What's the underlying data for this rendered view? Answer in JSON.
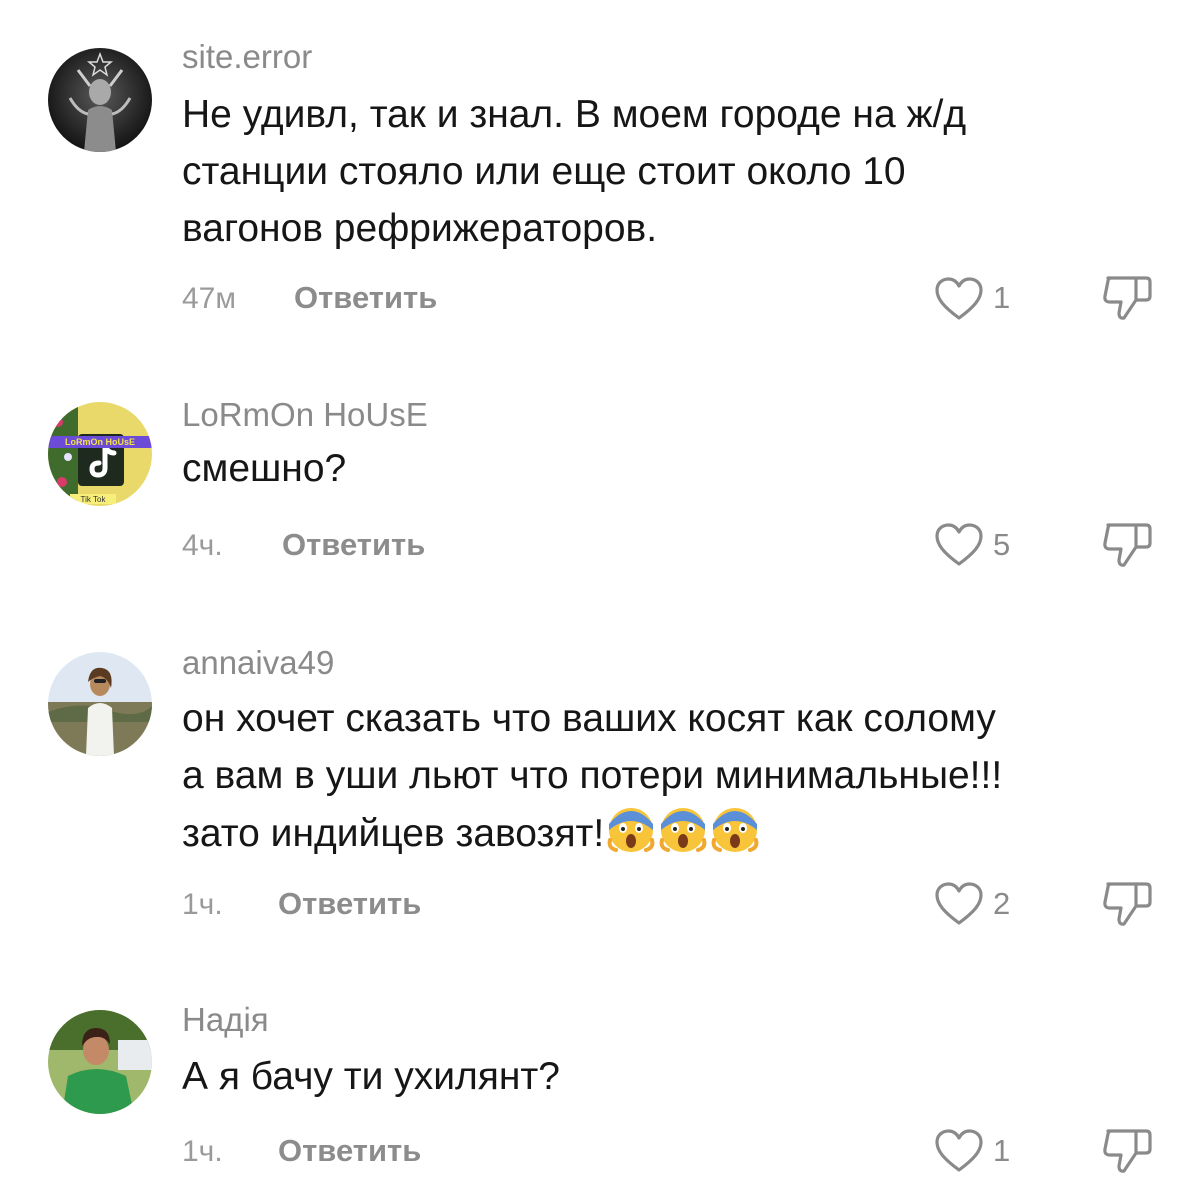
{
  "colors": {
    "username": "#8a8a8a",
    "text": "#161616",
    "meta": "#9a9a9a",
    "reply": "#8c8c8c",
    "icon": "#8a8a8a"
  },
  "comments": [
    {
      "username": "site.error",
      "text": "Не удивл, так и знал. В моем городе на ж/д\nстанции стояло или еще стоит около 10\nвагонов рефрижераторов.",
      "time": "47м",
      "reply_label": "Ответить",
      "likes": "1",
      "avatar_icon": "baphomet-avatar-icon"
    },
    {
      "username": "LoRmOn HoUsE",
      "text": "смешно?",
      "time": "4ч.",
      "reply_label": "Ответить",
      "likes": "5",
      "avatar_icon": "tiktok-logo-avatar-icon",
      "avatar_text": "LoRmOn HoUsE",
      "avatar_caption": "Tik Tok"
    },
    {
      "username": "annaiva49",
      "text": "он хочет сказать что ваших косят как солому\nа вам в уши льют что потери минимальные!!!\nзато индийцев завозят!",
      "emojis": [
        "screaming-face-emoji",
        "screaming-face-emoji",
        "screaming-face-emoji"
      ],
      "time": "1ч.",
      "reply_label": "Ответить",
      "likes": "2",
      "avatar_icon": "woman-photo-avatar-icon"
    },
    {
      "username": "Надія",
      "text": "А я бачу ти ухилянт?",
      "time": "1ч.",
      "reply_label": "Ответить",
      "likes": "1",
      "avatar_icon": "woman-green-shirt-avatar-icon"
    }
  ]
}
